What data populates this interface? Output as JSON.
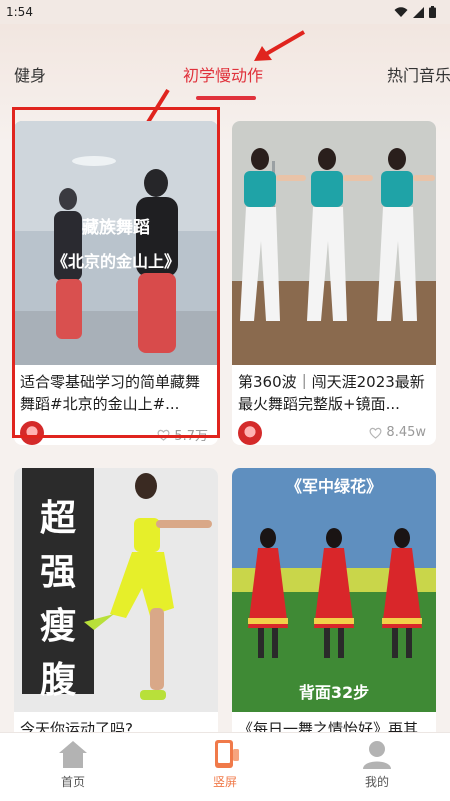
{
  "status_bar": {
    "time": "1:54"
  },
  "tabs": [
    {
      "label": "健身",
      "active": false
    },
    {
      "label": "初学慢动作",
      "active": true
    },
    {
      "label": "热门音乐",
      "active": false
    }
  ],
  "cards": [
    {
      "overlay_line1": "藏族舞蹈",
      "overlay_line2": "《北京的金山上》",
      "title": "适合零基础学习的简单藏舞舞蹈#北京的金山上#...",
      "likes": "5.7万"
    },
    {
      "title": "第360波｜闯天涯2023最新最火舞蹈完整版+镜面...",
      "likes": "8.45w"
    },
    {
      "overlay_chars": [
        "超",
        "强",
        "瘦",
        "腹"
      ],
      "title": "今天你运动了吗?"
    },
    {
      "overlay_top": "《军中绿花》",
      "overlay_bottom": "背面32步",
      "title": "《每日一舞之情怡好》再其"
    }
  ],
  "bottom_nav": [
    {
      "label": "首页",
      "icon": "home-icon",
      "active": false
    },
    {
      "label": "竖屏",
      "icon": "phone-vertical-icon",
      "active": true
    },
    {
      "label": "我的",
      "icon": "person-icon",
      "active": false
    }
  ],
  "colors": {
    "accent_red": "#e0323c",
    "nav_active": "#f07a4a",
    "annotation_red": "#e0241e"
  }
}
